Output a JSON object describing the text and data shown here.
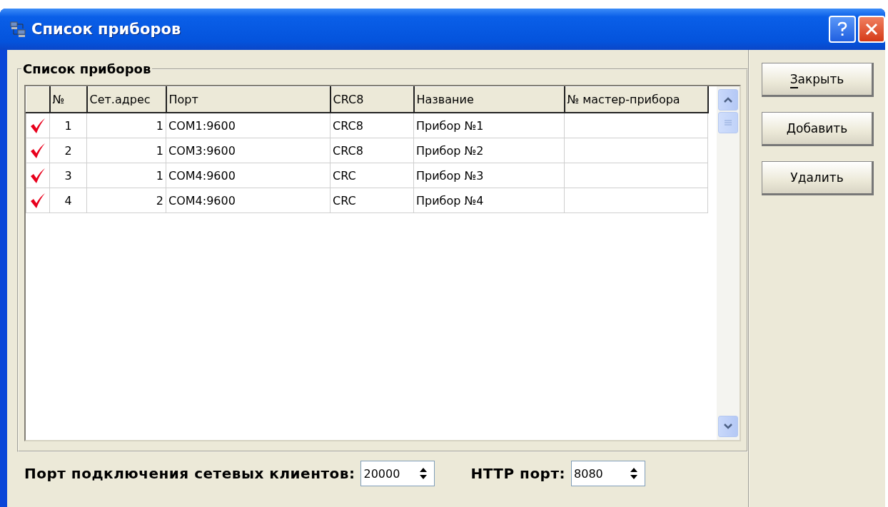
{
  "window": {
    "title": "Список приборов"
  },
  "group": {
    "title": "Список приборов"
  },
  "table": {
    "columns": [
      "№",
      "Сет.адрес",
      "Порт",
      "CRC8",
      "Название",
      "№ мастер-прибора"
    ],
    "rows": [
      {
        "checked": true,
        "cells": [
          "1",
          "1",
          "COM1:9600",
          "CRC8",
          "Прибор №1",
          ""
        ]
      },
      {
        "checked": true,
        "cells": [
          "2",
          "1",
          "COM3:9600",
          "CRC8",
          "Прибор №2",
          ""
        ]
      },
      {
        "checked": true,
        "cells": [
          "3",
          "1",
          "COM4:9600",
          "CRC",
          "Прибор №3",
          ""
        ]
      },
      {
        "checked": true,
        "cells": [
          "4",
          "2",
          "COM4:9600",
          "CRC",
          "Прибор №4",
          ""
        ]
      }
    ]
  },
  "client_port": {
    "label": "Порт подключения сетевых клиентов:",
    "value": "20000"
  },
  "http_port": {
    "label": "HTTP порт:",
    "value": "8080"
  },
  "buttons": [
    {
      "label": "Закрыть",
      "mnemonic": true
    },
    {
      "label": "Добавить",
      "mnemonic": false
    },
    {
      "label": "Удалить",
      "mnemonic": false
    }
  ]
}
